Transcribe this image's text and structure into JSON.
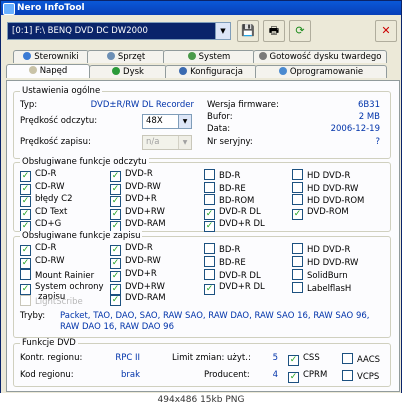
{
  "window": {
    "title": "Nero InfoTool"
  },
  "toolbar": {
    "drive_value": "[0:1]  F:\\ BENQ     DVD DC DW2000",
    "save_icon": "floppy-save-icon",
    "print_icon": "printer-icon",
    "refresh_icon": "refresh-icon",
    "close_icon": "close-x-icon"
  },
  "tabs_row1": [
    "Sterowniki",
    "Sprzęt",
    "System",
    "Gotowość dysku twardego"
  ],
  "tabs_row2": [
    "Napęd",
    "Dysk",
    "Konfiguracja",
    "Oprogramowanie"
  ],
  "general": {
    "title": "Ustawienia ogólne",
    "type_label": "Typ:",
    "type_value": "DVD±R/RW DL Recorder",
    "read_speed_label": "Prędkość odczytu:",
    "read_speed_value": "48X",
    "write_speed_label": "Prędkość zapisu:",
    "write_speed_value": "n/a",
    "firmware_label": "Wersja firmware:",
    "firmware_value": "6B31",
    "buffer_label": "Bufor:",
    "buffer_value": "2 MB",
    "date_label": "Data:",
    "date_value": "2006-12-19",
    "serial_label": "Nr seryjny:",
    "serial_value": "?"
  },
  "read": {
    "title": "Obsługiwane funkcje odczytu",
    "items": [
      {
        "label": "CD-R",
        "checked": true
      },
      {
        "label": "DVD-R",
        "checked": true
      },
      {
        "label": "BD-R",
        "checked": false
      },
      {
        "label": "HD DVD-R",
        "checked": false
      },
      {
        "label": "CD-RW",
        "checked": true
      },
      {
        "label": "DVD-RW",
        "checked": true
      },
      {
        "label": "BD-RE",
        "checked": false
      },
      {
        "label": "HD DVD-RW",
        "checked": false
      },
      {
        "label": "błędy C2",
        "checked": true
      },
      {
        "label": "DVD+R",
        "checked": true
      },
      {
        "label": "BD-ROM",
        "checked": false
      },
      {
        "label": "HD DVD-ROM",
        "checked": false
      },
      {
        "label": "CD Text",
        "checked": true
      },
      {
        "label": "DVD+RW",
        "checked": true
      },
      {
        "label": "DVD-R DL",
        "checked": true
      },
      {
        "label": "DVD-ROM",
        "checked": true
      },
      {
        "label": "CD+G",
        "checked": true
      },
      {
        "label": "DVD-RAM",
        "checked": true
      },
      {
        "label": "DVD+R DL",
        "checked": true
      }
    ]
  },
  "write": {
    "title": "Obsługiwane funkcje zapisu",
    "items": [
      {
        "label": "CD-R",
        "checked": true,
        "disabled": false
      },
      {
        "label": "DVD-R",
        "checked": true,
        "disabled": false
      },
      {
        "label": "BD-R",
        "checked": false,
        "disabled": false
      },
      {
        "label": "HD DVD-R",
        "checked": false,
        "disabled": false
      },
      {
        "label": "CD-RW",
        "checked": true,
        "disabled": false
      },
      {
        "label": "DVD-RW",
        "checked": true,
        "disabled": false
      },
      {
        "label": "BD-RE",
        "checked": false,
        "disabled": false
      },
      {
        "label": "HD DVD-RW",
        "checked": false,
        "disabled": false
      },
      {
        "label": "Mount Rainier",
        "checked": false,
        "disabled": false
      },
      {
        "label": "DVD+R",
        "checked": true,
        "disabled": false
      },
      {
        "label": "DVD-R DL",
        "checked": false,
        "disabled": false
      },
      {
        "label": "SolidBurn",
        "checked": false,
        "disabled": false
      },
      {
        "label": "System ochrony",
        "checked": true,
        "disabled": false
      },
      {
        "label": "DVD+RW",
        "checked": true,
        "disabled": false
      },
      {
        "label": "DVD+R DL",
        "checked": true,
        "disabled": false
      },
      {
        "label": "LabelflasH",
        "checked": false,
        "disabled": false
      },
      {
        "label": "LightScribe",
        "checked": false,
        "disabled": true
      }
    ],
    "protect_line2": "zapisu",
    "dvdram_label": "DVD-RAM",
    "modes_label": "Tryby:",
    "modes_value": "Packet, TAO, DAO, SAO, RAW SAO, RAW DAO, RAW SAO 16, RAW SAO 96, RAW DAO 16, RAW DAO 96"
  },
  "dvd": {
    "title": "Funkcje DVD",
    "region_ctrl_label": "Kontr. regionu:",
    "region_ctrl_value": "RPC II",
    "region_code_label": "Kod regionu:",
    "region_code_value": "brak",
    "limit_label": "Limit zmian: użyt.:",
    "limit_value": "5",
    "producer_label": "Producent:",
    "producer_value": "4",
    "css_label": "CSS",
    "cprm_label": "CPRM",
    "aacs_label": "AACS",
    "vcps_label": "VCPS"
  },
  "status": {
    "caption": "494x486 15kb PNG"
  },
  "colors": {
    "value_blue": "#0033aa",
    "check_green": "#21a121"
  }
}
